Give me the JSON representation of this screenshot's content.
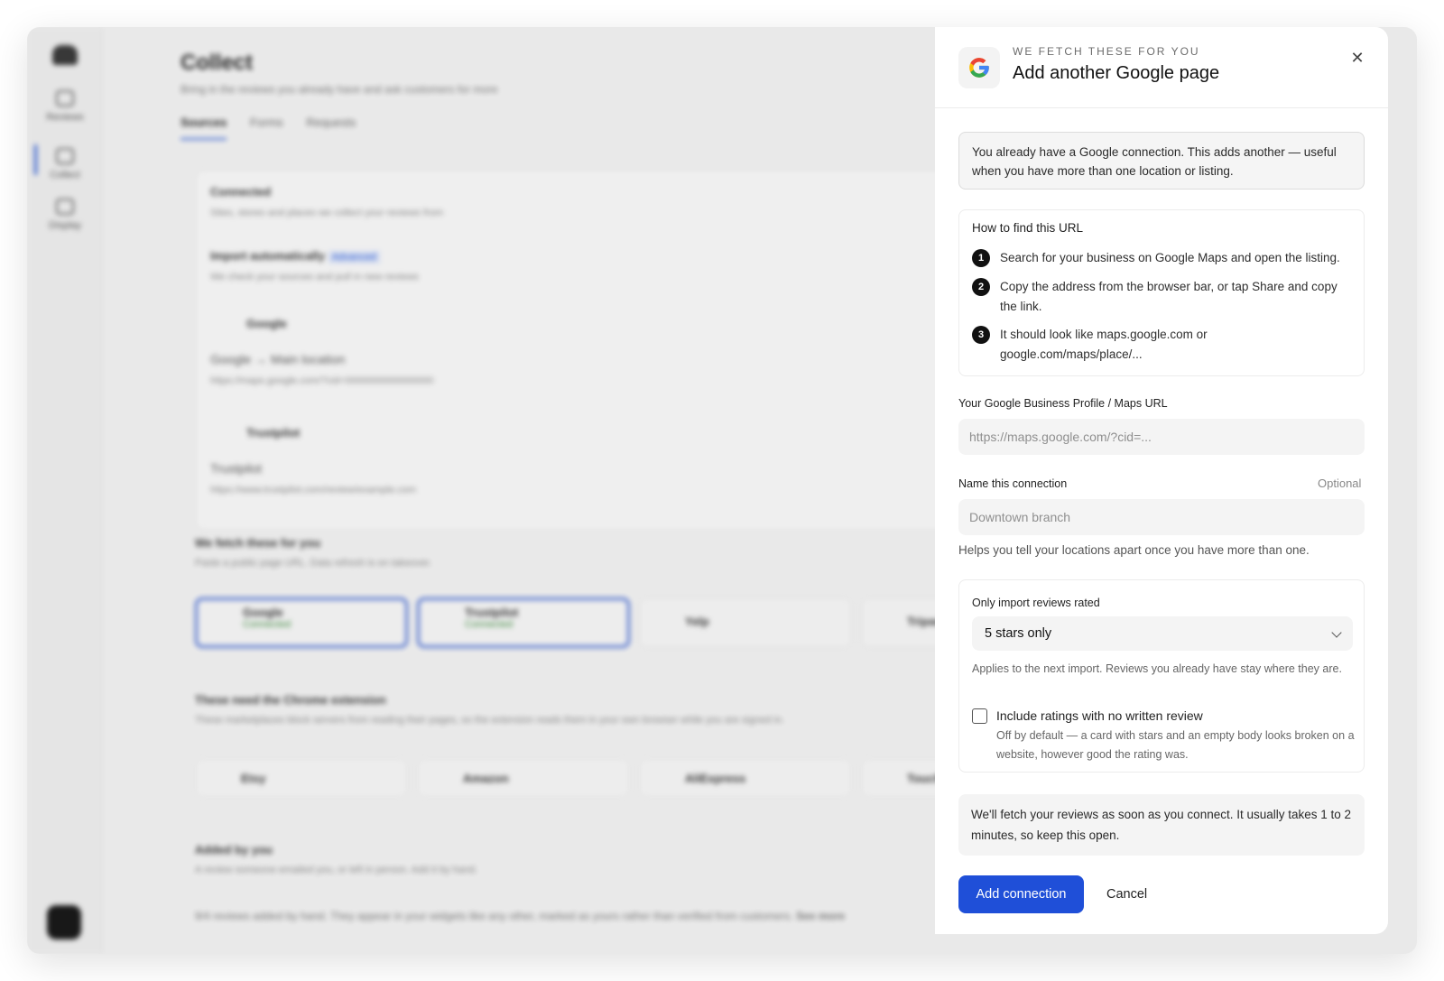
{
  "background": {
    "rail": {
      "items": [
        "Reviews",
        "Collect",
        "Display"
      ]
    },
    "page_title": "Collect",
    "page_subtitle": "Bring in the reviews you already have and ask customers for more",
    "tabs": [
      "Sources",
      "Forms",
      "Requests"
    ],
    "connected": {
      "heading": "Connected",
      "text": "Sites, stores and places we collect your reviews from",
      "import_label": "Import automatically",
      "import_badge": "Advanced",
      "import_text": "We check your sources and pull in new reviews",
      "sources": [
        {
          "name": "Google",
          "title": "Google → Main location",
          "url": "https://maps.google.com/?cid=0000000000000000"
        },
        {
          "name": "Trustpilot",
          "title": "Trustpilot",
          "url": "https://www.trustpilot.com/review/example.com"
        }
      ]
    },
    "fetch": {
      "heading": "We fetch these for you",
      "text": "Paste a public page URL. Data refresh is on takeover.",
      "tiles": [
        {
          "name": "Google",
          "status": "Connected"
        },
        {
          "name": "Trustpilot",
          "status": "Connected"
        },
        {
          "name": "Yelp",
          "status": ""
        },
        {
          "name": "Tripadvisor",
          "status": ""
        }
      ]
    },
    "extension": {
      "heading": "These need the Chrome extension",
      "text": "These marketplaces block servers from reading their pages, so the extension reads them in your own browser while you are signed in.",
      "tiles": [
        "Etsy",
        "Amazon",
        "AliExpress",
        "Touch"
      ]
    },
    "added": {
      "heading": "Added by you",
      "text": "A review someone emailed you, or left in person. Add it by hand.",
      "note": "9/4 reviews added by hand. They appear in your widgets like any other, marked as yours rather than verified from customers.",
      "note_link": "See more"
    }
  },
  "panel": {
    "eyebrow": "WE FETCH THESE FOR YOU",
    "title": "Add another Google page",
    "close_icon": "close-icon",
    "notice": "You already have a Google connection. This adds another — useful when you have more than one location or listing.",
    "howto": {
      "title": "How to find this URL",
      "steps": [
        {
          "num": "1",
          "text": "Search for your business on Google Maps and open the listing."
        },
        {
          "num": "2",
          "text": "Copy the address from the browser bar, or tap Share and copy the link."
        },
        {
          "num": "3",
          "text": "It should look like maps.google.com or google.com/maps/place/..."
        }
      ]
    },
    "url_field": {
      "label": "Your Google Business Profile / Maps URL",
      "placeholder": "https://maps.google.com/?cid=...",
      "value": ""
    },
    "name_field": {
      "label": "Name this connection",
      "optional": "Optional",
      "placeholder": "Downtown branch",
      "value": "",
      "helper": "Helps you tell your locations apart once you have more than one."
    },
    "rating": {
      "label": "Only import reviews rated",
      "selected": "5 stars only",
      "helper": "Applies to the next import. Reviews you already have stay where they are.",
      "checkbox_label": "Include ratings with no written review",
      "checkbox_checked": false,
      "checkbox_desc": "Off by default — a card with stars and an empty body looks broken on a website, however good the rating was."
    },
    "info": "We'll fetch your reviews as soon as you connect. It usually takes 1 to 2 minutes, so keep this open.",
    "primary_button": "Add connection",
    "cancel_button": "Cancel"
  },
  "colors": {
    "accent": "#1f4fd8",
    "google_blue": "#4285F4",
    "google_red": "#EA4335",
    "google_yellow": "#FBBC05",
    "google_green": "#34A853"
  }
}
